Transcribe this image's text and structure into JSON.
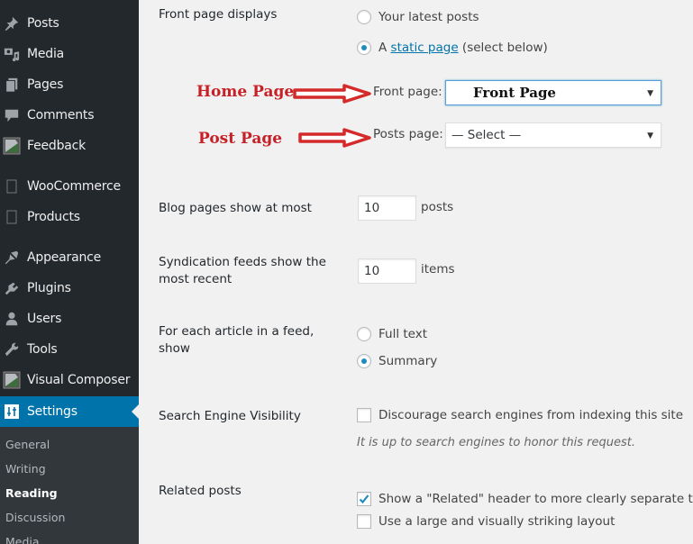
{
  "sidebar": {
    "items": [
      {
        "label": "Posts",
        "icon": "pin-icon"
      },
      {
        "label": "Media",
        "icon": "media-icon"
      },
      {
        "label": "Pages",
        "icon": "pages-icon"
      },
      {
        "label": "Comments",
        "icon": "comment-icon"
      },
      {
        "label": "Feedback",
        "icon": "feedback-image-icon"
      },
      {
        "label": "WooCommerce",
        "icon": "woocommerce-icon"
      },
      {
        "label": "Products",
        "icon": "products-icon"
      },
      {
        "label": "Appearance",
        "icon": "paintbrush-icon"
      },
      {
        "label": "Plugins",
        "icon": "plug-icon"
      },
      {
        "label": "Users",
        "icon": "user-icon"
      },
      {
        "label": "Tools",
        "icon": "wrench-icon"
      },
      {
        "label": "Visual Composer",
        "icon": "visual-composer-icon"
      },
      {
        "label": "Settings",
        "icon": "settings-sliders-icon",
        "active": true
      }
    ],
    "submenu": [
      {
        "label": "General"
      },
      {
        "label": "Writing"
      },
      {
        "label": "Reading",
        "current": true
      },
      {
        "label": "Discussion"
      },
      {
        "label": "Media"
      }
    ]
  },
  "reading": {
    "front_page_displays": {
      "label": "Front page displays",
      "options": {
        "latest_posts": "Your latest posts",
        "static_prefix": "A",
        "static_link": "static page",
        "static_suffix": "(select below)"
      },
      "selected": "static"
    },
    "front_page_select": {
      "label": "Front page:",
      "value": "Front Page"
    },
    "posts_page_select": {
      "label": "Posts page:",
      "value": "— Select —"
    },
    "annotations": {
      "home": "Home Page",
      "post": "Post Page",
      "color": "#c62127"
    },
    "blog_pages": {
      "label": "Blog pages show at most",
      "value": "10",
      "unit": "posts"
    },
    "syndication": {
      "label_line1": "Syndication feeds show the",
      "label_line2": "most recent",
      "value": "10",
      "unit": "items"
    },
    "feed_article": {
      "label_line1": "For each article in a feed,",
      "label_line2": "show",
      "options": {
        "full": "Full text",
        "summary": "Summary"
      },
      "selected": "summary"
    },
    "search_visibility": {
      "label": "Search Engine Visibility",
      "checkbox_label": "Discourage search engines from indexing this site",
      "checked": false,
      "description": "It is up to search engines to honor this request."
    },
    "related_posts": {
      "label": "Related posts",
      "header_option": "Show a \"Related\" header to more clearly separate the",
      "header_checked": true,
      "large_option": "Use a large and visually striking layout",
      "large_checked": false
    }
  },
  "colors": {
    "sidebar_bg": "#23282d",
    "active_bg": "#0073aa",
    "submenu_bg": "#32373c",
    "link": "#0073aa"
  }
}
